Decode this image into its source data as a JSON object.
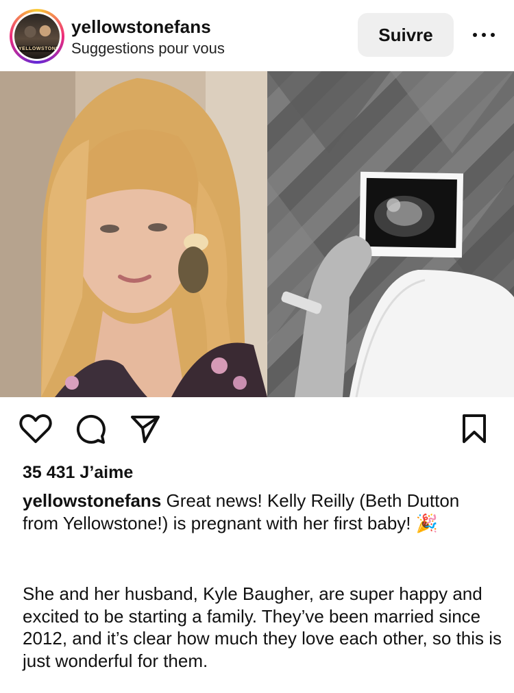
{
  "post": {
    "username": "yellowstonefans",
    "subtitle": "Suggestions pour vous",
    "avatar_tag": "YELLOWSTONE",
    "follow_label": "Suivre",
    "likes": "35 431 J’aime",
    "caption_user": "yellowstonefans",
    "caption_text": "Great news! Kelly Reilly (Beth Dutton from Yellowstone!) is pregnant with her first baby! 🎉",
    "caption_para2": "She and her husband, Kyle Baugher, are super happy and excited to be starting a family. They’ve been married since 2012, and it’s clear how much they love each other, so this is just wonderful for them."
  },
  "icons": {
    "more": "more-options-icon",
    "like": "heart-icon",
    "comment": "comment-icon",
    "share": "send-icon",
    "save": "bookmark-icon"
  },
  "colors": {
    "ring_gradient": [
      "#f9ce34",
      "#ee2a7b",
      "#6228d7"
    ],
    "button_bg": "#efefef",
    "text": "#111111"
  }
}
